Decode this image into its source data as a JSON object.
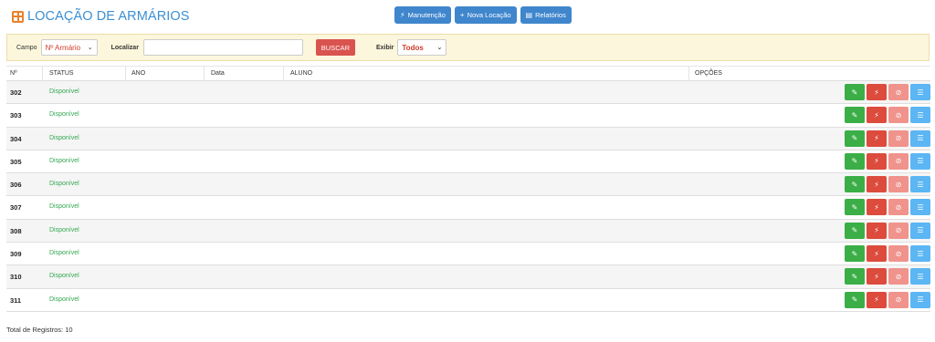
{
  "header": {
    "title": "LOCAÇÃO DE ARMÁRIOS",
    "logo_icon": "grid-icon",
    "title_color": "#3a8fd3",
    "logo_color": "#e8822c"
  },
  "toolbar": {
    "manutencao_label": "Manutenção",
    "nova_locacao_label": "Nova Locação",
    "relatorios_label": "Relatórios"
  },
  "filter": {
    "campo_label": "Campo",
    "campo_value": "Nº Armário",
    "localizar_label": "Localizar",
    "localizar_value": "",
    "buscar_label": "BUSCAR",
    "exibir_label": "Exibir",
    "exibir_value": "Todos"
  },
  "table": {
    "headers": [
      "Nº",
      "STATUS",
      "ANO",
      "Data",
      "ALUNO",
      "OPÇÕES"
    ],
    "rows": [
      {
        "num": "302",
        "status": "Disponível"
      },
      {
        "num": "303",
        "status": "Disponível"
      },
      {
        "num": "304",
        "status": "Disponível"
      },
      {
        "num": "305",
        "status": "Disponível"
      },
      {
        "num": "306",
        "status": "Disponível"
      },
      {
        "num": "307",
        "status": "Disponível"
      },
      {
        "num": "308",
        "status": "Disponível"
      },
      {
        "num": "309",
        "status": "Disponível"
      },
      {
        "num": "310",
        "status": "Disponível"
      },
      {
        "num": "311",
        "status": "Disponível"
      }
    ],
    "action_icons": [
      "pencil-icon",
      "bolt-icon",
      "ban-icon",
      "list-icon"
    ]
  },
  "footer": {
    "total_label": "Total de Registros: 10"
  },
  "colors": {
    "primary": "#3f86cd",
    "danger": "#d9534f",
    "success": "#3cae47",
    "status_available": "#34a853"
  }
}
